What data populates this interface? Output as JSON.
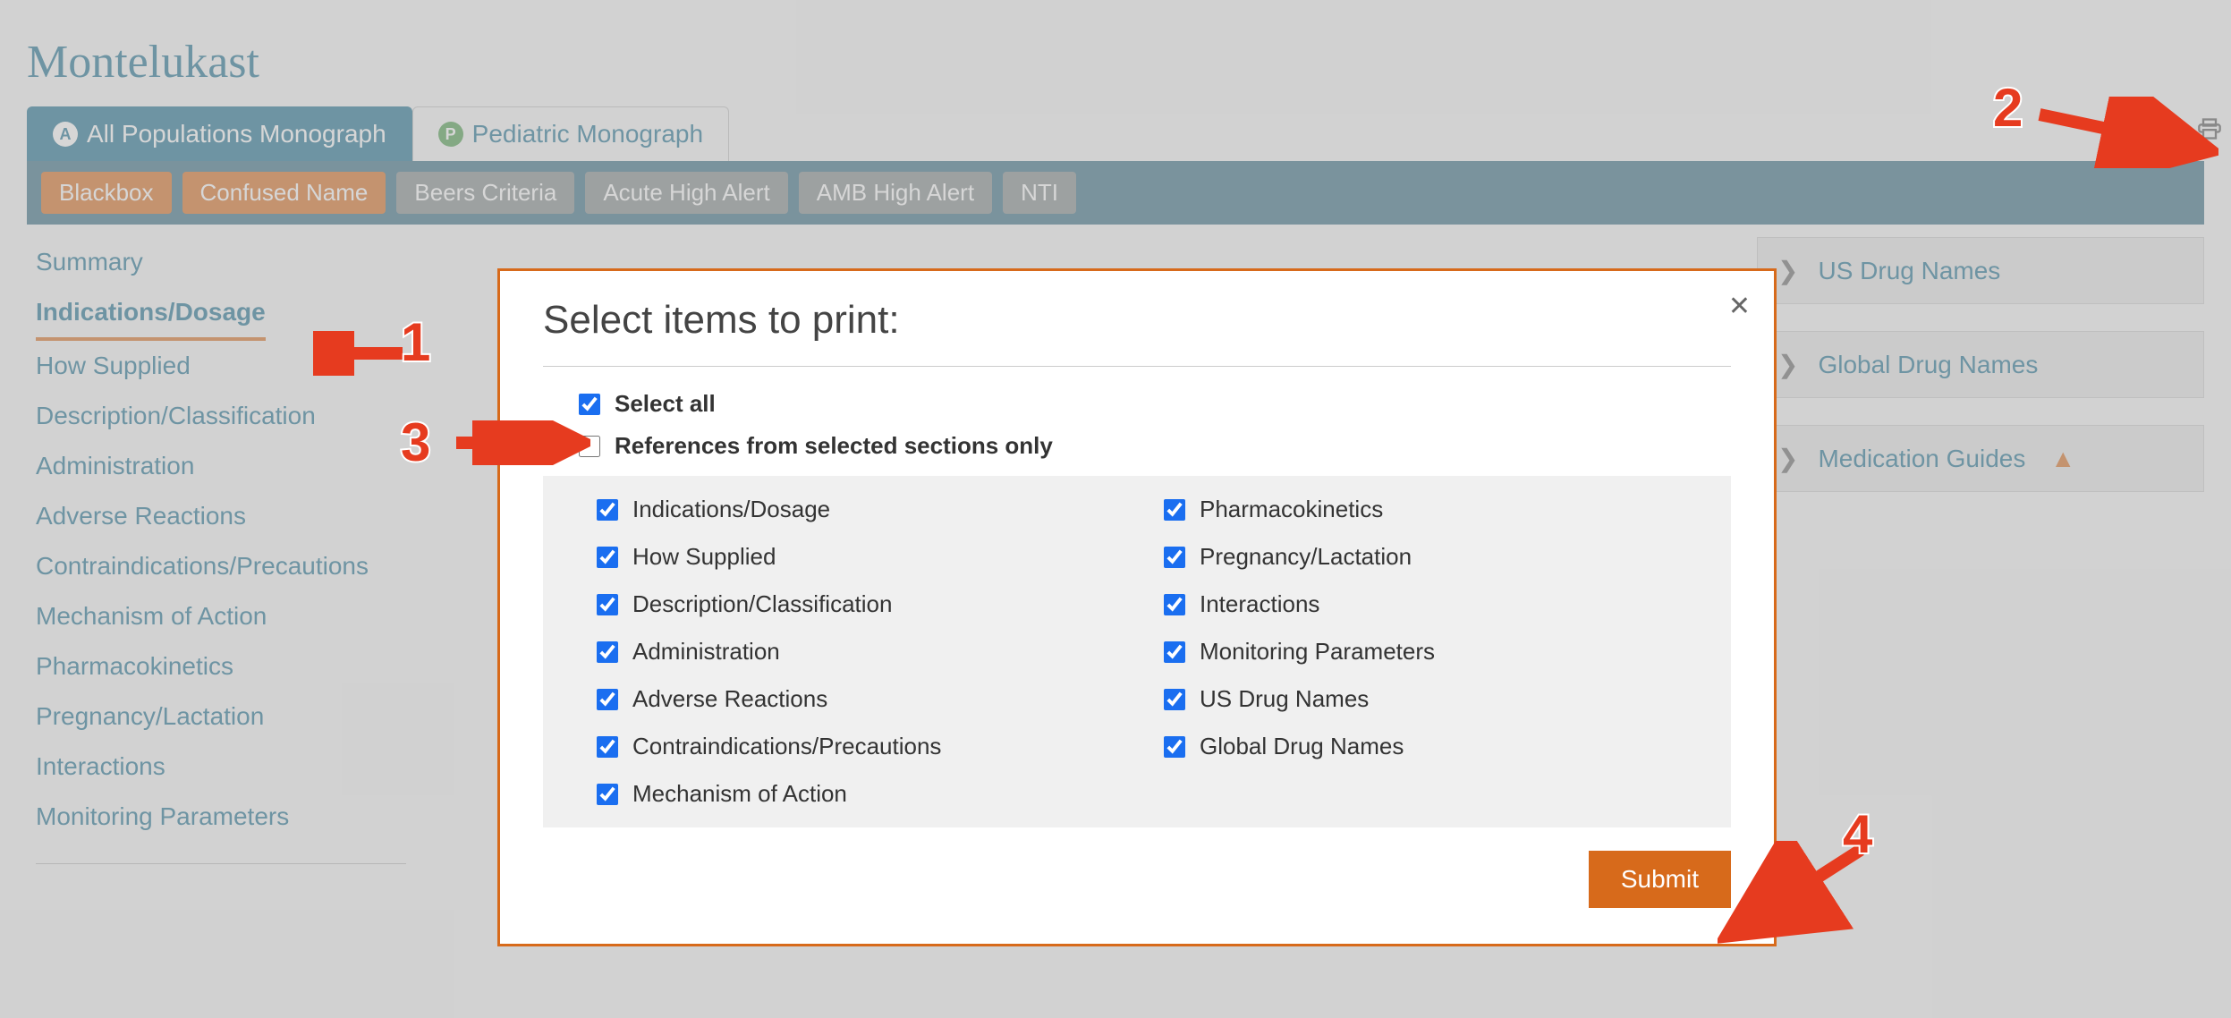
{
  "drugName": "Montelukast",
  "tabs": [
    {
      "badge": "A",
      "label": "All Populations Monograph",
      "active": true
    },
    {
      "badge": "P",
      "label": "Pediatric Monograph",
      "active": false
    }
  ],
  "alerts": [
    {
      "label": "Blackbox",
      "active": true
    },
    {
      "label": "Confused Name",
      "active": true
    },
    {
      "label": "Beers Criteria",
      "active": false
    },
    {
      "label": "Acute High Alert",
      "active": false
    },
    {
      "label": "AMB High Alert",
      "active": false
    },
    {
      "label": "NTI",
      "active": false
    }
  ],
  "leftNav": [
    {
      "label": "Summary",
      "active": false
    },
    {
      "label": "Indications/Dosage",
      "active": true
    },
    {
      "label": "How Supplied",
      "active": false
    },
    {
      "label": "Description/Classification",
      "active": false
    },
    {
      "label": "Administration",
      "active": false
    },
    {
      "label": "Adverse Reactions",
      "active": false
    },
    {
      "label": "Contraindications/Precautions",
      "active": false
    },
    {
      "label": "Mechanism of Action",
      "active": false
    },
    {
      "label": "Pharmacokinetics",
      "active": false
    },
    {
      "label": "Pregnancy/Lactation",
      "active": false
    },
    {
      "label": "Interactions",
      "active": false
    },
    {
      "label": "Monitoring Parameters",
      "active": false
    }
  ],
  "rightPanel": [
    {
      "label": "US Drug Names",
      "warn": false
    },
    {
      "label": "Global Drug Names",
      "warn": false
    },
    {
      "label": "Medication Guides",
      "warn": true
    }
  ],
  "modal": {
    "title": "Select items to print:",
    "selectAll": {
      "label": "Select all",
      "checked": true
    },
    "refsOnly": {
      "label": "References from selected sections only",
      "checked": false
    },
    "itemsCol1": [
      {
        "label": "Indications/Dosage",
        "checked": true
      },
      {
        "label": "How Supplied",
        "checked": true
      },
      {
        "label": "Description/Classification",
        "checked": true
      },
      {
        "label": "Administration",
        "checked": true
      },
      {
        "label": "Adverse Reactions",
        "checked": true
      },
      {
        "label": "Contraindications/Precautions",
        "checked": true
      },
      {
        "label": "Mechanism of Action",
        "checked": true
      }
    ],
    "itemsCol2": [
      {
        "label": "Pharmacokinetics",
        "checked": true
      },
      {
        "label": "Pregnancy/Lactation",
        "checked": true
      },
      {
        "label": "Interactions",
        "checked": true
      },
      {
        "label": "Monitoring Parameters",
        "checked": true
      },
      {
        "label": "US Drug Names",
        "checked": true
      },
      {
        "label": "Global Drug Names",
        "checked": true
      }
    ],
    "submit": "Submit"
  },
  "annotations": [
    "1",
    "2",
    "3",
    "4"
  ]
}
